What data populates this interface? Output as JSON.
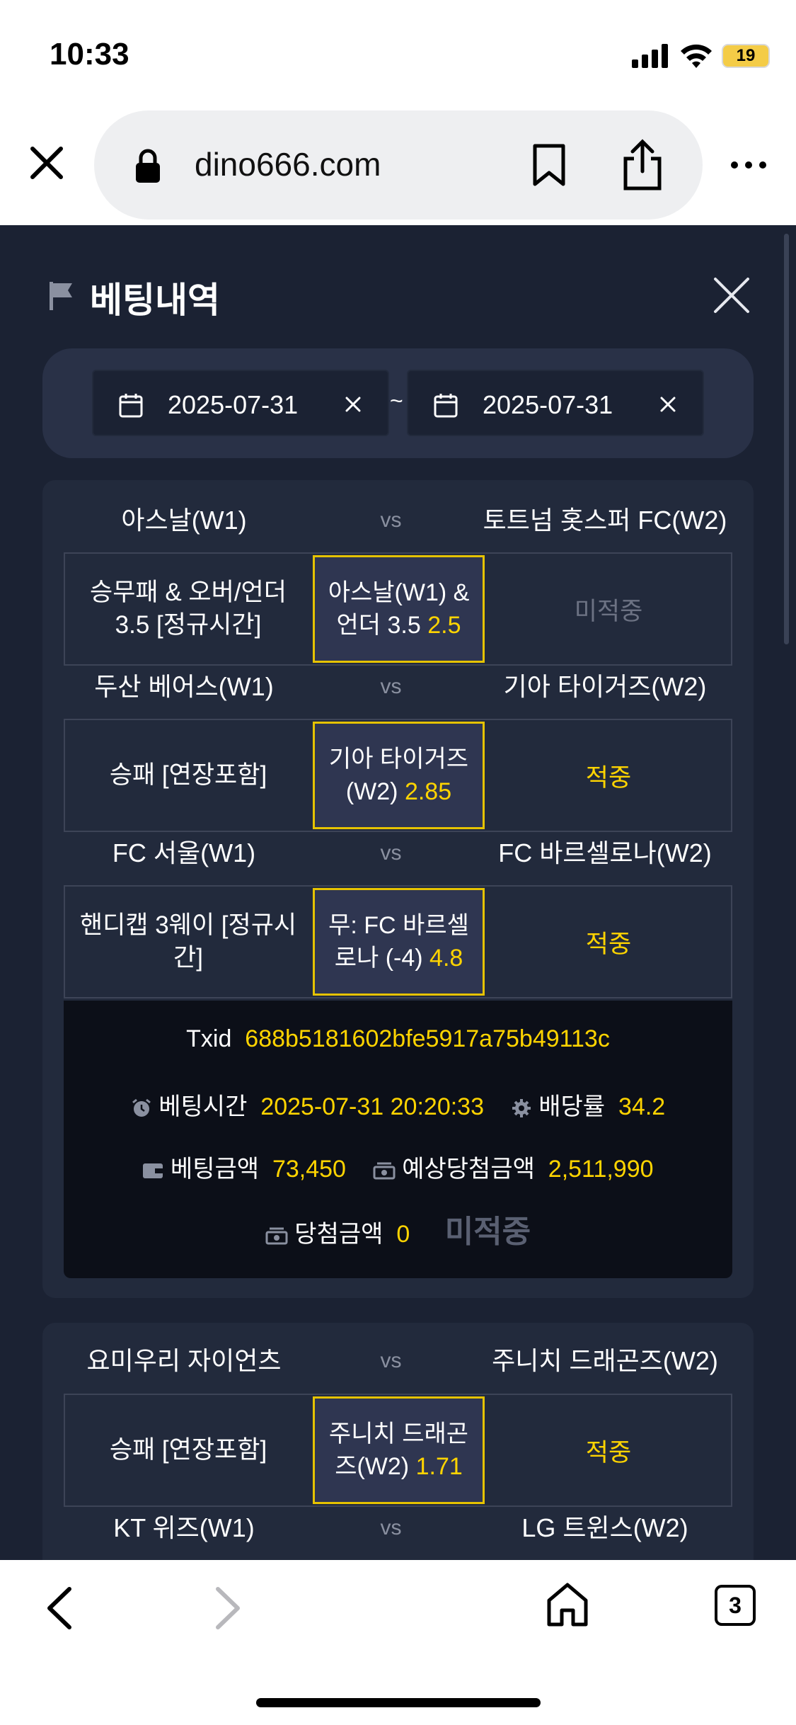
{
  "status_bar": {
    "time": "10:33",
    "battery": "19"
  },
  "browser": {
    "url": "dino666.com",
    "tab_count": "3"
  },
  "modal": {
    "title": "베팅내역"
  },
  "date_filter": {
    "start": "2025-07-31",
    "end": "2025-07-31",
    "separator": "~"
  },
  "vs_label": "vs",
  "card1": {
    "bets": [
      {
        "team1": "아스날(W1)",
        "team2": "토트넘 홋스퍼 FC(W2)",
        "market": "승무패 & 오버/언더 3.5 [정규시간]",
        "pick": "아스날(W1) & 언더 3.5",
        "odds": "2.5",
        "result": "미적중"
      },
      {
        "team1": "두산 베어스(W1)",
        "team2": "기아 타이거즈(W2)",
        "market": "승패 [연장포함]",
        "pick": "기아 타이거즈(W2)",
        "odds": "2.85",
        "result": "적중"
      },
      {
        "team1": "FC 서울(W1)",
        "team2": "FC 바르셀로나(W2)",
        "market": "핸디캡 3웨이 [정규시간]",
        "pick": "무: FC 바르셀로나 (-4)",
        "odds": "4.8",
        "result": "적중"
      }
    ],
    "summary": {
      "txid_label": "Txid",
      "txid": "688b5181602bfe5917a75b49113c",
      "bet_time_label": "베팅시간",
      "bet_time": "2025-07-31 20:20:33",
      "odds_label": "배당률",
      "odds": "34.2",
      "bet_amount_label": "베팅금액",
      "bet_amount": "73,450",
      "expected_label": "예상당첨금액",
      "expected": "2,511,990",
      "win_label": "당첨금액",
      "win": "0",
      "status": "미적중"
    }
  },
  "card2": {
    "bets": [
      {
        "team1": "요미우리 자이언츠(W1)",
        "team2": "주니치 드래곤즈(W2)",
        "market": "승패 [연장포함]",
        "pick": "주니치 드래곤즈(W2)",
        "odds": "1.71",
        "result": "적중"
      }
    ],
    "next_match": {
      "team1": "KT 위즈(W1)",
      "team2": "LG 트윈스(W2)"
    }
  }
}
